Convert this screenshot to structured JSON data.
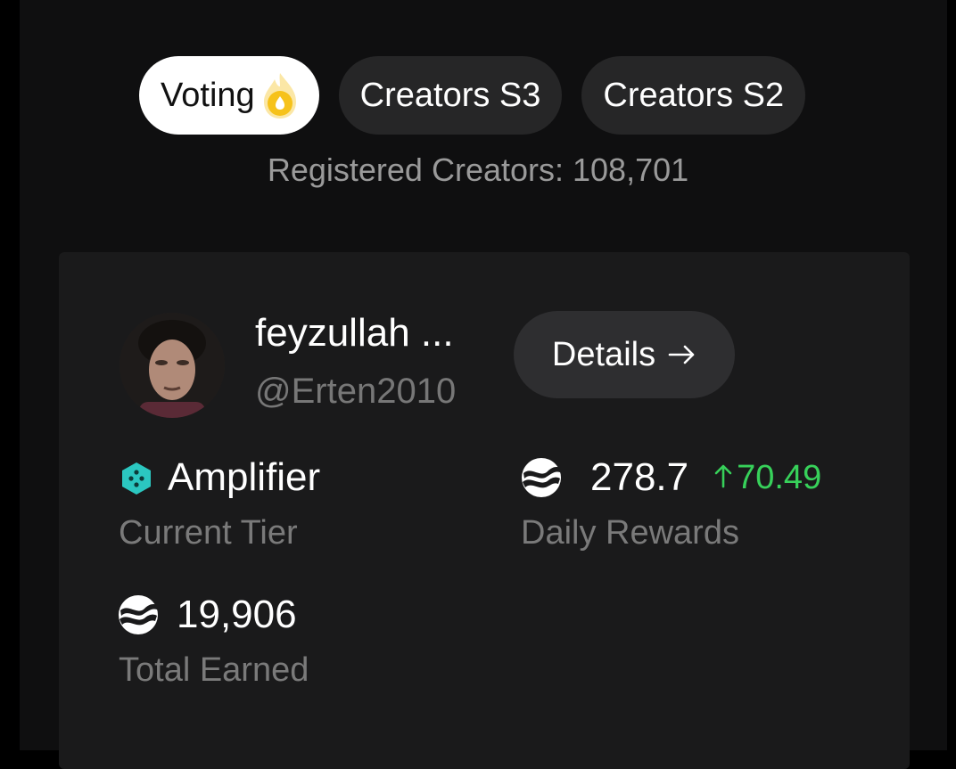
{
  "tabs": [
    {
      "label": "Voting",
      "icon": "flame-icon",
      "active": true
    },
    {
      "label": "Creators S3",
      "active": false
    },
    {
      "label": "Creators S2",
      "active": false
    }
  ],
  "registered": {
    "text": "Registered Creators: 108,701"
  },
  "creator": {
    "name": "feyzullah ...",
    "handle": "@Erten2010",
    "details_label": "Details",
    "tier": {
      "value": "Amplifier",
      "label": "Current Tier",
      "icon": "tier-hexagon-icon"
    },
    "daily_rewards": {
      "value": "278.7",
      "delta": "70.49",
      "label": "Daily Rewards"
    },
    "total_earned": {
      "value": "19,906",
      "label": "Total Earned"
    }
  },
  "colors": {
    "accent_green": "#37d15a",
    "tier_teal": "#2bc7c0",
    "flame": "#f6c21b"
  }
}
